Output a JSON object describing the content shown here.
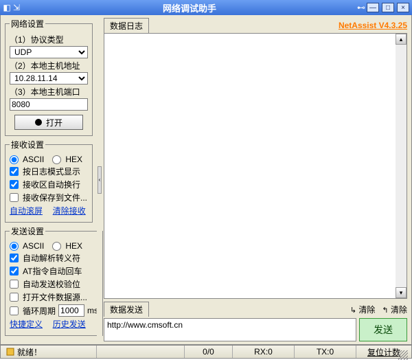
{
  "window": {
    "title": "网络调试助手",
    "version_link": "NetAssist V4.3.25"
  },
  "net_settings": {
    "legend": "网络设置",
    "protocol_label": "（1）协议类型",
    "protocol_value": "UDP",
    "host_label": "（2）本地主机地址",
    "host_value": "10.28.11.14",
    "port_label": "（3）本地主机端口",
    "port_value": "8080",
    "open_button": "打开"
  },
  "recv_settings": {
    "legend": "接收设置",
    "ascii": "ASCII",
    "hex": "HEX",
    "log_mode": "按日志模式显示",
    "auto_wrap": "接收区自动换行",
    "save_file": "接收保存到文件...",
    "auto_scroll": "自动滚屏",
    "clear_recv": "清除接收"
  },
  "send_settings": {
    "legend": "发送设置",
    "ascii": "ASCII",
    "hex": "HEX",
    "auto_escape": "自动解析转义符",
    "at_echo": "AT指令自动回车",
    "auto_checksum": "自动发送校验位",
    "open_file_src": "打开文件数据源...",
    "cycle_label_pre": "循环周期",
    "cycle_value": "1000",
    "cycle_label_post": "ms",
    "shortcut": "快捷定义",
    "history": "历史发送"
  },
  "main": {
    "log_tab": "数据日志",
    "send_tab": "数据发送",
    "clear1": "清除",
    "clear2": "清除",
    "send_text": "http://www.cmsoft.cn",
    "send_button": "发送"
  },
  "status": {
    "ready": "就绪！",
    "counter1": "0/0",
    "rx": "RX:0",
    "tx": "TX:0",
    "reset": "复位计数"
  }
}
